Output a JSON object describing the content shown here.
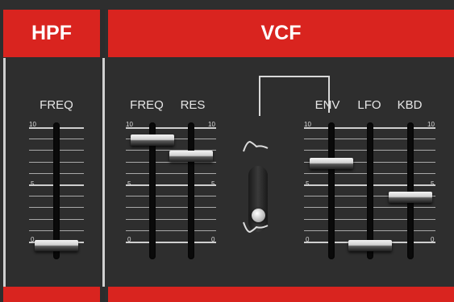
{
  "sections": {
    "hpf": {
      "title": "HPF"
    },
    "vcf": {
      "title": "VCF"
    }
  },
  "hpf_freq": {
    "label": "FREQ",
    "scale_max": "10",
    "scale_mid": "5",
    "scale_min": "0",
    "value": 0.0
  },
  "vcf_freq": {
    "label": "FREQ",
    "scale_max": "10",
    "scale_mid": "5",
    "scale_min": "0",
    "value": 0.92
  },
  "vcf_res": {
    "label": "RES",
    "scale_max": "10",
    "scale_mid": "5",
    "scale_min": "0",
    "value": 0.78
  },
  "vcf_env": {
    "label": "ENV",
    "scale_max": "10",
    "scale_mid": "5",
    "scale_min": "0",
    "value": 0.72
  },
  "vcf_lfo": {
    "label": "LFO",
    "value": 0.0
  },
  "vcf_kbd": {
    "label": "KBD",
    "scale_max": "10",
    "scale_mid": "5",
    "scale_min": "0",
    "value": 0.42
  },
  "polarity_switch": {
    "position": "down",
    "icons": [
      "positive-envelope-icon",
      "negative-envelope-icon"
    ]
  },
  "colors": {
    "accent": "#d9241f",
    "panel": "#2e2e2e",
    "text": "#e6e6e6"
  }
}
